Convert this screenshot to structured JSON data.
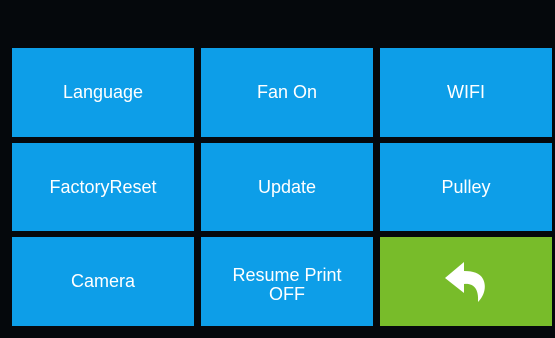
{
  "colors": {
    "background": "#05080c",
    "tile": "#0d9ee8",
    "back_tile": "#78bc2a",
    "text": "#ffffff"
  },
  "menu": {
    "tiles": [
      {
        "label": "Language"
      },
      {
        "label": "Fan On"
      },
      {
        "label": "WIFI"
      },
      {
        "label": "FactoryReset"
      },
      {
        "label": "Update"
      },
      {
        "label": "Pulley"
      },
      {
        "label": "Camera"
      },
      {
        "label": "Resume Print\nOFF"
      }
    ],
    "back": {
      "icon": "back-arrow-icon"
    }
  }
}
